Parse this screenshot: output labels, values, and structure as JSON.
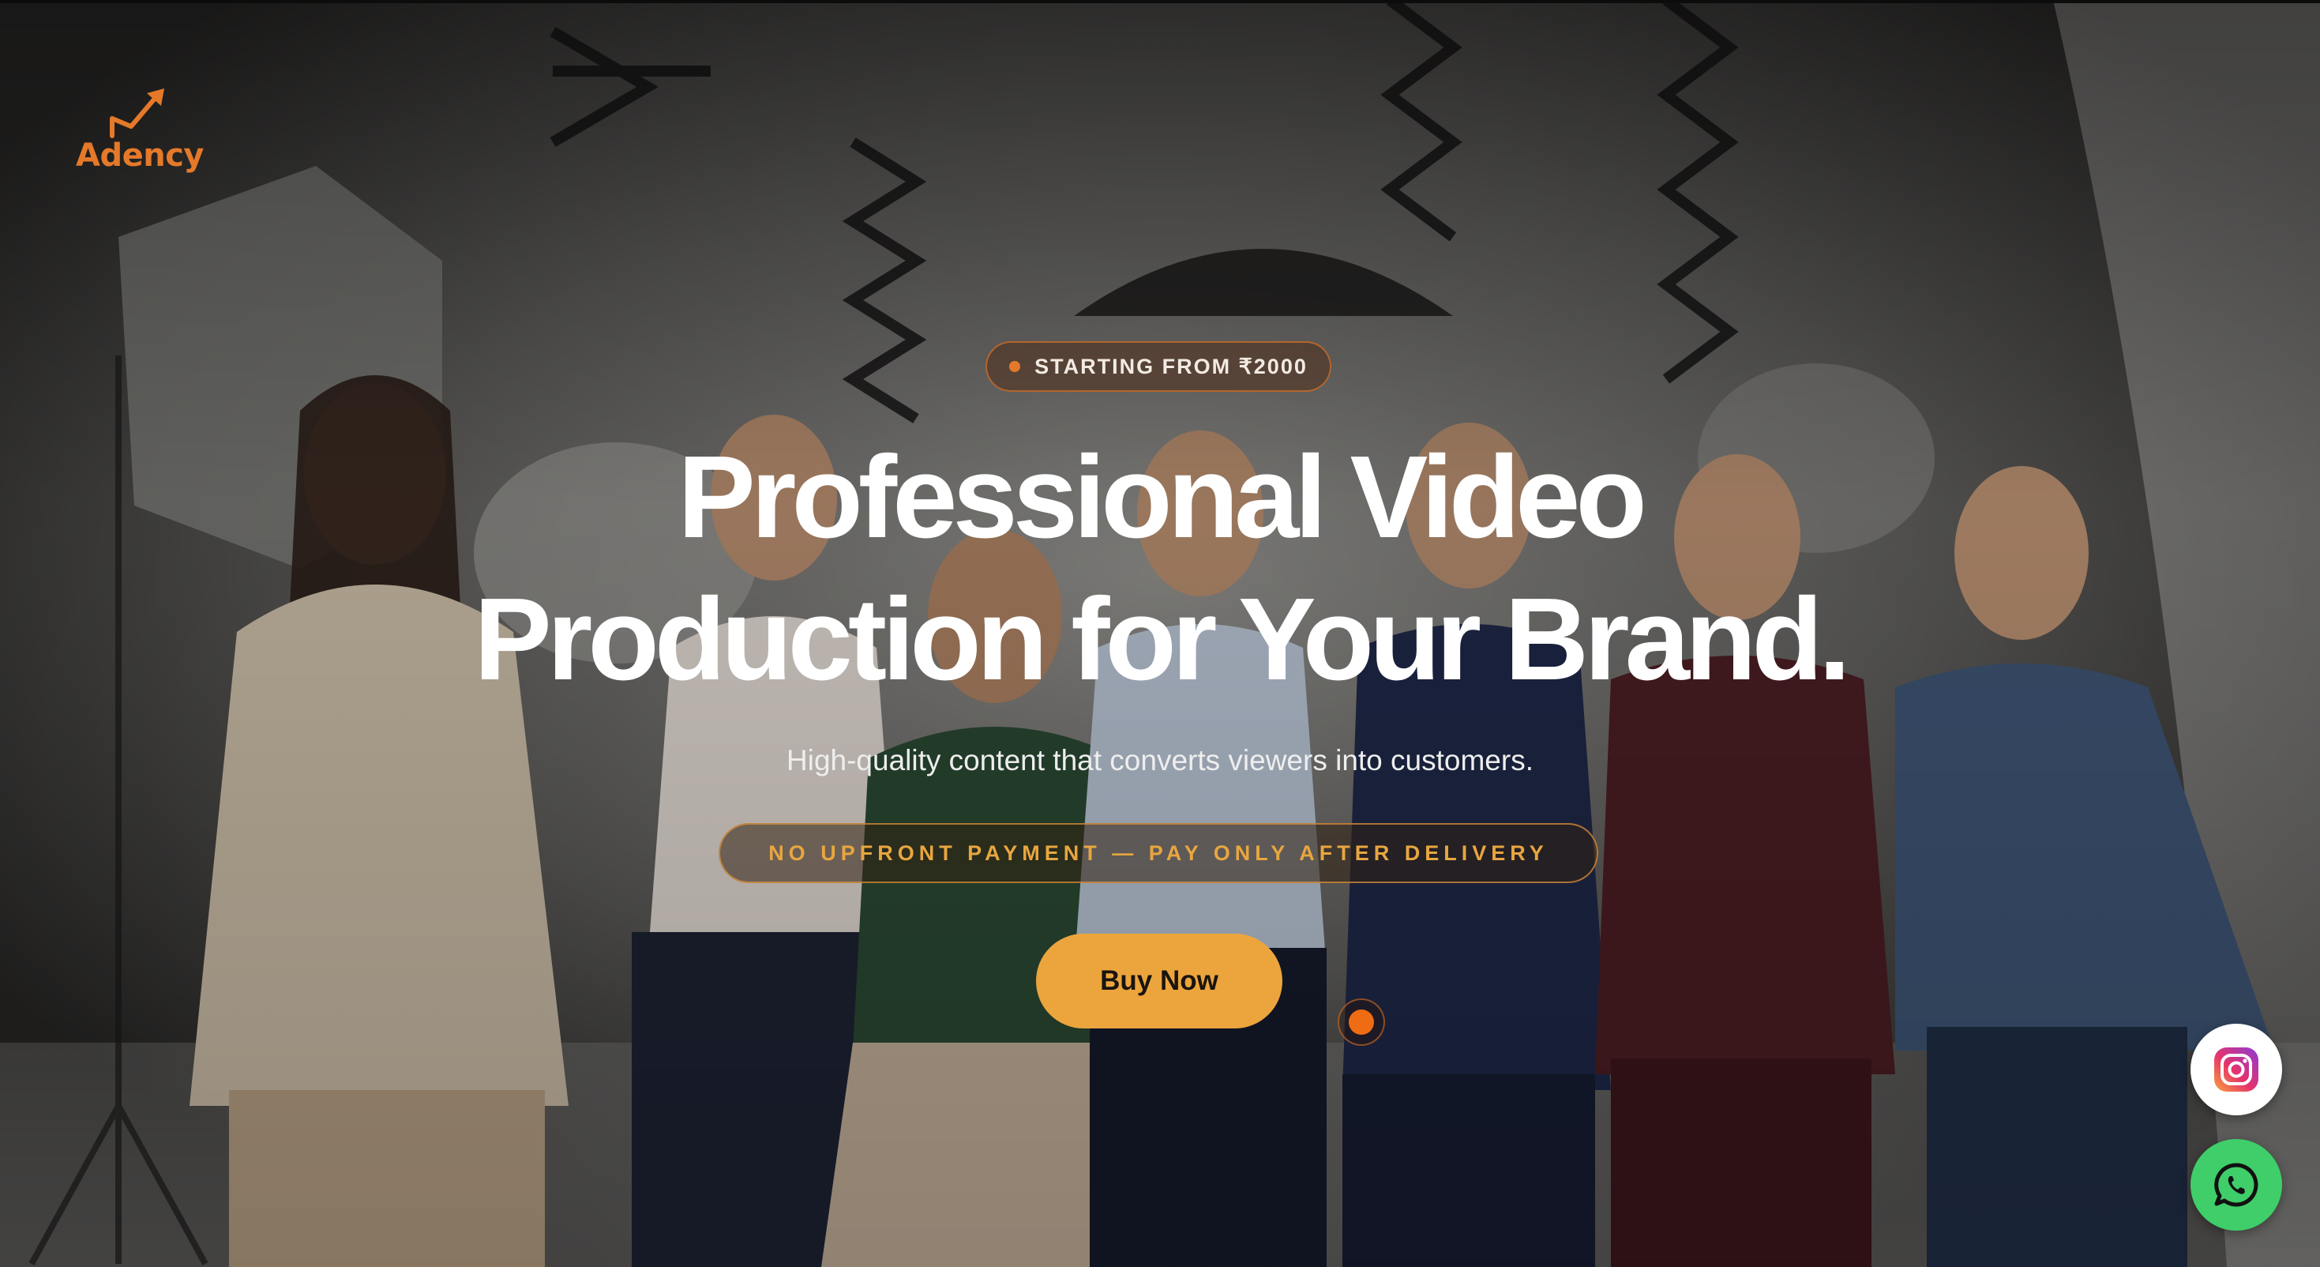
{
  "brand": {
    "logo_text": "Adency",
    "accent_color": "#e5792a"
  },
  "hero": {
    "badge_text": "STARTING FROM ₹2000",
    "headline_line1": "Professional Video",
    "headline_line2": "Production for Your Brand.",
    "subheadline": "High-quality content that converts viewers into customers.",
    "guarantee_text": "NO UPFRONT PAYMENT — PAY ONLY AFTER DELIVERY",
    "cta_label": "Buy Now",
    "cta_color": "#eca53d",
    "background_image": "team-photo-in-studio"
  },
  "carousel": {
    "active_index": 1,
    "total": 1
  },
  "floating_actions": [
    {
      "name": "instagram",
      "icon": "instagram-icon",
      "color": "#ffffff"
    },
    {
      "name": "whatsapp",
      "icon": "whatsapp-icon",
      "color": "#3fce69"
    }
  ]
}
